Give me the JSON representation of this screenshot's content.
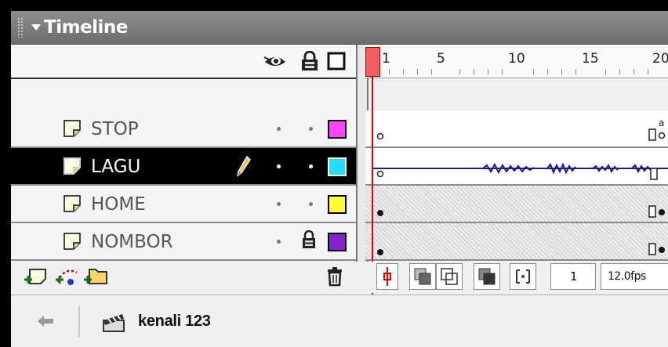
{
  "panel": {
    "title": "Timeline",
    "colors": {
      "titlebar": "#7a7a7a",
      "selected_row": "#000000",
      "playhead": "#f06060",
      "sound_wave": "#1a1a8c"
    }
  },
  "ruler": {
    "labels": [
      "1",
      "5",
      "10",
      "15",
      "20"
    ]
  },
  "layers": [
    {
      "name": "STOP",
      "color": "#ff44ff",
      "selected": false,
      "locked": false
    },
    {
      "name": "LAGU",
      "color": "#22ddff",
      "selected": true,
      "locked": false
    },
    {
      "name": "HOME",
      "color": "#ffff33",
      "selected": false,
      "locked": false
    },
    {
      "name": "NOMBOR",
      "color": "#8822cc",
      "selected": false,
      "locked": true
    }
  ],
  "status": {
    "current_frame": "1",
    "frame_rate": "12.0fps"
  },
  "breadcrumb": {
    "scene": "kenali 123"
  }
}
